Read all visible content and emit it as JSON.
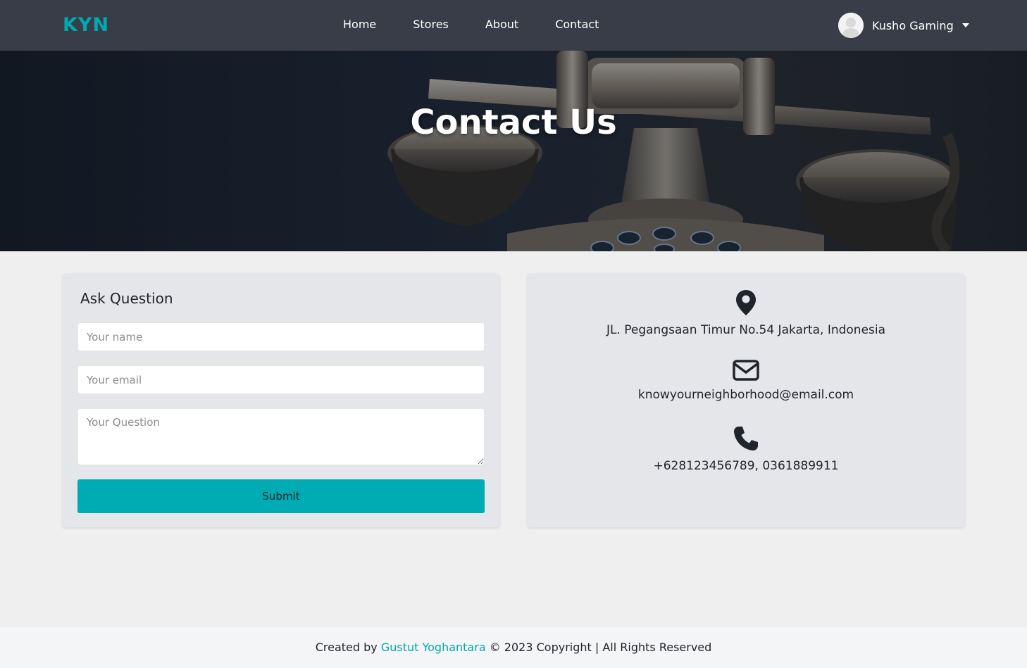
{
  "navbar": {
    "brand": "KYN",
    "links": [
      "Home",
      "Stores",
      "About",
      "Contact"
    ],
    "user": {
      "name": "Kusho Gaming",
      "avatar_icon": "user-avatar-icon"
    }
  },
  "hero": {
    "title": "Contact Us"
  },
  "form": {
    "title": "Ask Question",
    "name_placeholder": "Your name",
    "email_placeholder": "Your email",
    "question_placeholder": "Your Question",
    "submit_label": "Submit"
  },
  "info": {
    "address": "JL. Pegangsaan Timur No.54 Jakarta, Indonesia",
    "email": "knowyourneighborhood@email.com",
    "phone": "+628123456789, 0361889911",
    "icons": [
      "map-pin-icon",
      "envelope-icon",
      "phone-icon"
    ]
  },
  "footer": {
    "prefix": "Created by",
    "author": "Gustut Yoghantara",
    "suffix": "© 2023 Copyright | All Rights Reserved"
  },
  "colors": {
    "accent": "#00acb3",
    "navbar": "#393d47",
    "card": "#e5e6ea",
    "page": "#efeff0"
  }
}
